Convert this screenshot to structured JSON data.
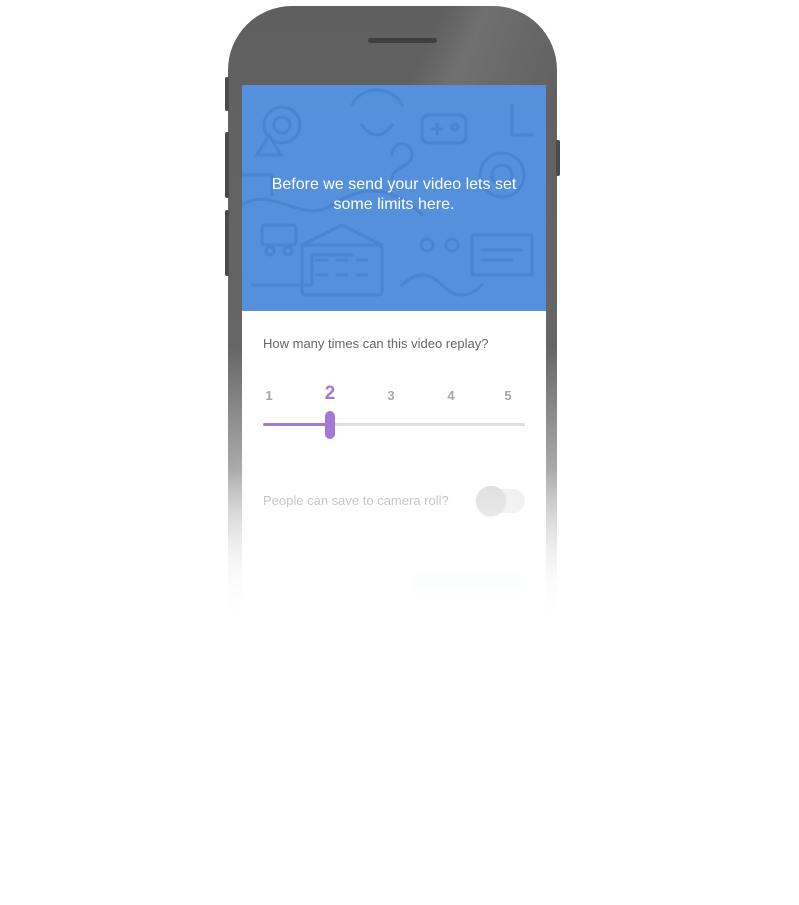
{
  "intro": {
    "title": "Before we send your video lets set some limits here."
  },
  "replay": {
    "question": "How many times can this video replay?",
    "options": [
      "1",
      "2",
      "3",
      "4",
      "5"
    ],
    "selected_value": 2,
    "min": 1,
    "max": 5
  },
  "camera_roll": {
    "label": "People can save to camera roll?",
    "enabled": false
  },
  "colors": {
    "hero_background": "#5590dc",
    "accent_purple": "#a27ad6",
    "toggle_off": "#dcdcdc",
    "button_hint": "#edf9f4"
  },
  "icons": [
    "background-illustration-pattern"
  ]
}
